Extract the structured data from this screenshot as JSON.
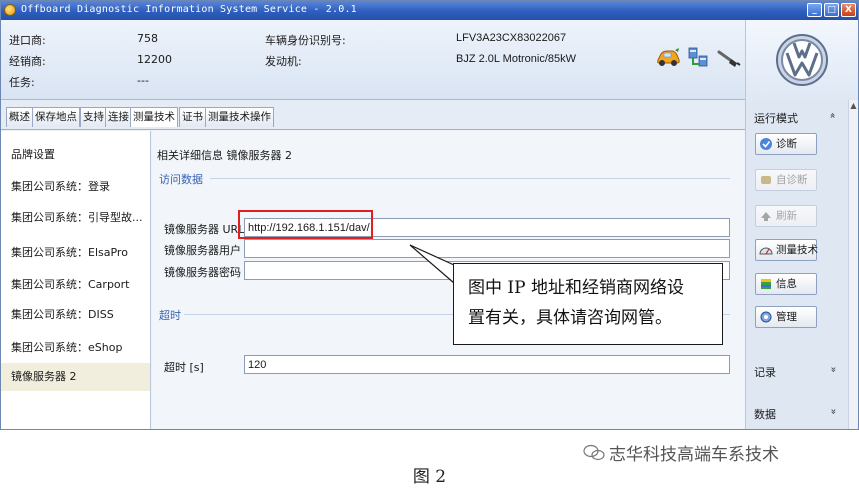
{
  "window": {
    "title": "Offboard Diagnostic Information System Service - 2.0.1",
    "min_label": "_",
    "max_label": "□",
    "close_label": "X"
  },
  "header": {
    "importer_label": "进口商:",
    "importer_value": "758",
    "dealer_label": "经销商:",
    "dealer_value": "12200",
    "task_label": "任务:",
    "task_value": "---",
    "vin_label": "车辆身份识别号:",
    "vin_value": "LFV3A23CX83022067",
    "engine_label": "发动机:",
    "engine_value": "BJZ 2.0L Motronic/85kW",
    "icons": [
      "car-icon",
      "network-icon",
      "cable-plug-icon"
    ],
    "logo": "vw-logo"
  },
  "tabs": [
    "概述",
    "保存地点",
    "支持",
    "连接",
    "测量技术",
    "证书",
    "测量技术操作"
  ],
  "nav": {
    "items": [
      "品牌设置",
      "集团公司系统：登录",
      "集团公司系统：引导型故...",
      "集团公司系统：ElsaPro",
      "集团公司系统：Carport",
      "集团公司系统：DISS",
      "集团公司系统：eShop",
      "镜像服务器 2"
    ],
    "selected_index": 7
  },
  "content": {
    "breadcrumb": "相关详细信息 镜像服务器 2",
    "section_access": "访问数据",
    "url_label": "镜像服务器 URL",
    "url_value": "http://192.168.1.151/dav/",
    "user_label": "镜像服务器用户",
    "user_value": "",
    "password_label": "镜像服务器密码",
    "password_value": "",
    "section_timeout": "超时",
    "timeout_label": "超时 [s]",
    "timeout_value": "120"
  },
  "right_panel": {
    "mode_title": "运行模式",
    "mode_chevron": "»",
    "buttons": [
      {
        "label": "诊断",
        "icon": "diagnosis-icon",
        "enabled": true
      },
      {
        "label": "自诊断",
        "icon": "self-diagnosis-icon",
        "enabled": false
      },
      {
        "label": "刷新",
        "icon": "flash-icon",
        "enabled": false
      },
      {
        "label": "测量技术",
        "icon": "meter-icon",
        "enabled": true
      },
      {
        "label": "信息",
        "icon": "info-icon",
        "enabled": true
      },
      {
        "label": "管理",
        "icon": "admin-icon",
        "enabled": true
      }
    ],
    "records_title": "记录",
    "records_chevron": "»",
    "data_title": "数据",
    "data_chevron": "»"
  },
  "callout": {
    "line1": "图中 IP 地址和经销商网络设",
    "line2": "置有关，具体请咨询网管。"
  },
  "watermark": "志华科技高端车系技术",
  "caption": "图 2",
  "colors": {
    "titlebar": "#2e5fbf",
    "highlight": "#e02020",
    "section": "#3b63b3",
    "selected_nav": "#f1eedd"
  }
}
